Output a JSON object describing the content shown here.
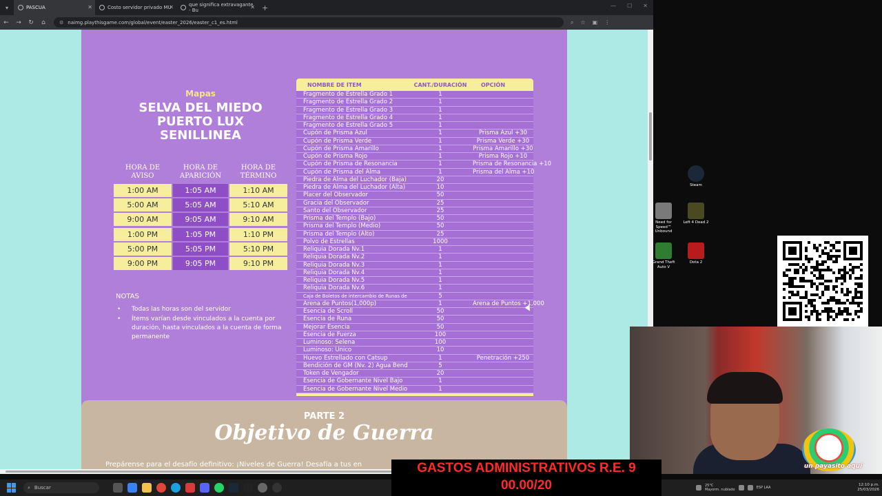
{
  "browser": {
    "tabs": [
      {
        "label": "PASCUA",
        "active": true
      },
      {
        "label": "Costo servidor privado MU",
        "active": false
      },
      {
        "label": "que significa extravagante - Bu",
        "active": false
      }
    ],
    "url": "naimg.playthisgame.com/global/event/easter_2026/easter_c1_es.html"
  },
  "event": {
    "maps_label": "Mapas",
    "map_names": [
      "SELVA DEL MIEDO",
      "PUERTO LUX",
      "SENILLINEA"
    ],
    "schedule": {
      "headers": [
        "HORA DE AVISO",
        "HORA DE APARICIÓN",
        "HORA DE TÉRMINO"
      ],
      "rows": [
        [
          "1:00 AM",
          "1:05 AM",
          "1:10 AM"
        ],
        [
          "5:00 AM",
          "5:05 AM",
          "5:10 AM"
        ],
        [
          "9:00 AM",
          "9:05 AM",
          "9:10 AM"
        ],
        [
          "1:00 PM",
          "1:05 PM",
          "1:10 PM"
        ],
        [
          "5:00 PM",
          "5:05 PM",
          "5:10 PM"
        ],
        [
          "9:00 PM",
          "9:05 PM",
          "9:10 PM"
        ]
      ]
    },
    "notes_title": "NOTAS",
    "notes": [
      "Todas las horas son del servidor",
      "Ítems varían desde vinculados a la cuenta por duración, hasta vinculados a la cuenta de forma permanente"
    ],
    "table": {
      "headers": [
        "NOMBRE DE ÍTEM",
        "CANT./DURACIÓN",
        "OPCIÓN"
      ],
      "rows": [
        [
          "Fragmento de Estrella Grado 1",
          "1",
          ""
        ],
        [
          "Fragmento de Estrella Grado 2",
          "1",
          ""
        ],
        [
          "Fragmento de Estrella Grado 3",
          "1",
          ""
        ],
        [
          "Fragmento de Estrella Grado 4",
          "1",
          ""
        ],
        [
          "Fragmento de Estrella Grado 5",
          "1",
          ""
        ],
        [
          "Cupón de Prisma Azul",
          "1",
          "Prisma Azul +30"
        ],
        [
          "Cupón de Prisma Verde",
          "1",
          "Prisma Verde +30"
        ],
        [
          "Cupón de Prisma Amarillo",
          "1",
          "Prisma Amarillo +30"
        ],
        [
          "Cupón de Prisma Rojo",
          "1",
          "Prisma Rojo +10"
        ],
        [
          "Cupón de Prisma de Resonancia",
          "1",
          "Prisma de Resonancia +10"
        ],
        [
          "Cupón de Prisma del Alma",
          "1",
          "Prisma del Alma +10"
        ],
        [
          "Piedra de Alma del Luchador (Baja)",
          "20",
          ""
        ],
        [
          "Piedra de Alma del Luchador (Alta)",
          "10",
          ""
        ],
        [
          "Placer del Observador",
          "50",
          ""
        ],
        [
          "Gracia del Observador",
          "25",
          ""
        ],
        [
          "Santo del Observador",
          "25",
          ""
        ],
        [
          "Prisma del Templo (Bajo)",
          "50",
          ""
        ],
        [
          "Prisma del Templo (Medio)",
          "50",
          ""
        ],
        [
          "Prisma del Templo (Alto)",
          "25",
          ""
        ],
        [
          "Polvo de Estrellas",
          "1000",
          ""
        ],
        [
          "Reliquia Dorada Nv.1",
          "1",
          ""
        ],
        [
          "Reliquia Dorada Nv.2",
          "1",
          ""
        ],
        [
          "Reliquia Dorada Nv.3",
          "1",
          ""
        ],
        [
          "Reliquia Dorada Nv.4",
          "1",
          ""
        ],
        [
          "Reliquia Dorada Nv.5",
          "1",
          ""
        ],
        [
          "Reliquia Dorada Nv.6",
          "1",
          ""
        ],
        [
          "Caja de Boletos de intercambio de Runas de Karma (Morada)",
          "5",
          ""
        ],
        [
          "Arena de Puntos(1,000p)",
          "1",
          "Arena de Puntos +1,000"
        ],
        [
          "Esencia de Scroll",
          "50",
          ""
        ],
        [
          "Esencia de Runa",
          "50",
          ""
        ],
        [
          "Mejorar Esencia",
          "50",
          ""
        ],
        [
          "Esencia de Fuerza",
          "100",
          ""
        ],
        [
          "Luminoso: Selena",
          "100",
          ""
        ],
        [
          "Luminoso: Único",
          "10",
          ""
        ],
        [
          "Huevo Estrellado con Catsup",
          "1",
          "Penetración +250"
        ],
        [
          "Bendición de GM (Nv. 2) Agua Bendita",
          "5",
          ""
        ],
        [
          "Token de Vengador",
          "20",
          ""
        ],
        [
          "Esencia de Gobernante Nivel Bajo",
          "1",
          ""
        ],
        [
          "Esencia de Gobernante Nivel Medio",
          "1",
          ""
        ]
      ]
    },
    "part2": {
      "label": "PARTE 2",
      "title": "Objetivo de Guerra",
      "intro": "Prepárense para el desafío definitivo: ¡Niveles de Guerra! Desafía a tus en"
    }
  },
  "desktop": {
    "icons": [
      {
        "label": "Steam",
        "color": "#1b2838"
      },
      {
        "label": "Need for Speed™ Unbound",
        "color": "#7a7a7a"
      },
      {
        "label": "Left 4 Dead 2",
        "color": "#4a4a20"
      },
      {
        "label": "Grand Theft Auto V",
        "color": "#2e7d32"
      },
      {
        "label": "Dota 2",
        "color": "#b71c1c"
      }
    ]
  },
  "stream": {
    "banner_line1": "GASTOS ADMINISTRATIVOS R.E. 9",
    "banner_line2": "00.00/20",
    "overlay_text": "un payasito aquí"
  },
  "taskbar": {
    "search_placeholder": "Buscar",
    "weather_temp": "25°C",
    "weather_desc": "Mayorm. nublado",
    "lang": "ESP LAA",
    "time": "12:10 p.m.",
    "date": "25/03/2026"
  }
}
